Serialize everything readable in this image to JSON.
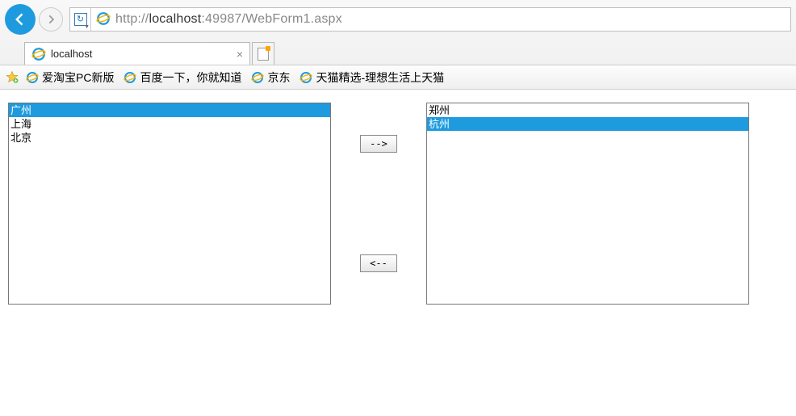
{
  "addressBar": {
    "url_prefix": "http://",
    "url_host": "localhost",
    "url_suffix": ":49987/WebForm1.aspx"
  },
  "tab": {
    "title": "localhost"
  },
  "favorites": [
    {
      "label": "爱淘宝PC新版"
    },
    {
      "label": "百度一下，你就知道"
    },
    {
      "label": "京东"
    },
    {
      "label": "天猫精选-理想生活上天猫"
    }
  ],
  "leftList": {
    "items": [
      {
        "label": "广州",
        "selected": true
      },
      {
        "label": "上海",
        "selected": false
      },
      {
        "label": "北京",
        "selected": false
      }
    ]
  },
  "rightList": {
    "items": [
      {
        "label": "郑州",
        "selected": false
      },
      {
        "label": "杭州",
        "selected": true
      }
    ]
  },
  "buttons": {
    "moveRight": "-->",
    "moveLeft": "<--"
  }
}
